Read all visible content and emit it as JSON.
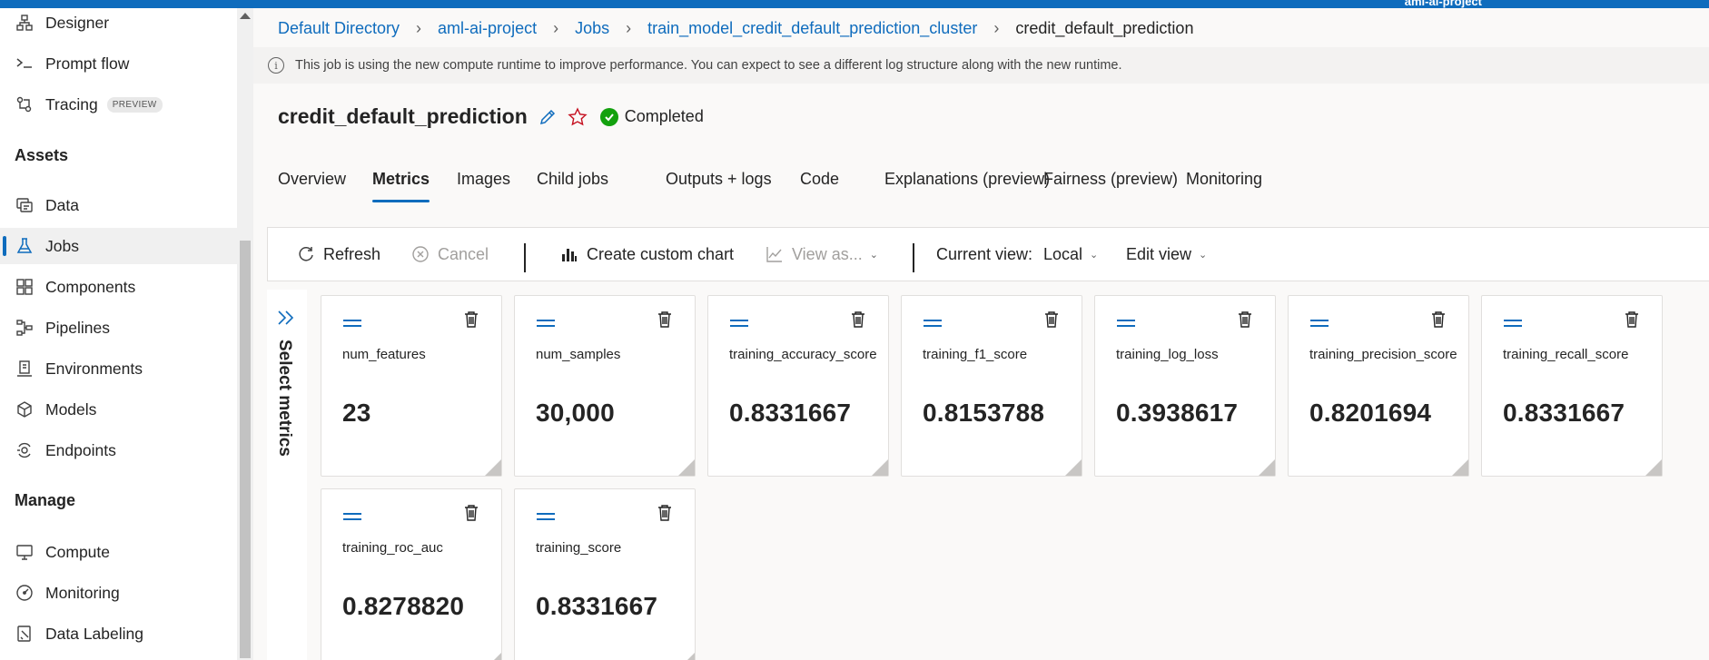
{
  "topbar": {
    "project_name": "aml-ai-project"
  },
  "sidebar": {
    "items": [
      {
        "label": "Designer",
        "icon": "designer-icon"
      },
      {
        "label": "Prompt flow",
        "icon": "prompt-flow-icon"
      },
      {
        "label": "Tracing",
        "icon": "tracing-icon",
        "badge": "PREVIEW"
      }
    ],
    "assets_heading": "Assets",
    "assets": [
      {
        "label": "Data",
        "icon": "data-icon"
      },
      {
        "label": "Jobs",
        "icon": "jobs-icon",
        "active": true
      },
      {
        "label": "Components",
        "icon": "components-icon"
      },
      {
        "label": "Pipelines",
        "icon": "pipelines-icon"
      },
      {
        "label": "Environments",
        "icon": "environments-icon"
      },
      {
        "label": "Models",
        "icon": "models-icon"
      },
      {
        "label": "Endpoints",
        "icon": "endpoints-icon"
      }
    ],
    "manage_heading": "Manage",
    "manage": [
      {
        "label": "Compute",
        "icon": "compute-icon"
      },
      {
        "label": "Monitoring",
        "icon": "monitoring-icon"
      },
      {
        "label": "Data Labeling",
        "icon": "data-labeling-icon"
      }
    ]
  },
  "breadcrumb": {
    "items": [
      "Default Directory",
      "aml-ai-project",
      "Jobs",
      "train_model_credit_default_prediction_cluster"
    ],
    "current": "credit_default_prediction"
  },
  "info_bar": {
    "message": "This job is using the new compute runtime to improve performance. You can expect to see a different log structure along with the new runtime."
  },
  "job": {
    "title": "credit_default_prediction",
    "status": "Completed",
    "status_color": "#13a10e"
  },
  "tabs": [
    {
      "label": "Overview"
    },
    {
      "label": "Metrics",
      "active": true
    },
    {
      "label": "Images"
    },
    {
      "label": "Child jobs"
    },
    {
      "label": "Outputs + logs"
    },
    {
      "label": "Code"
    },
    {
      "label": "Explanations (preview)"
    },
    {
      "label": "Fairness (preview)"
    },
    {
      "label": "Monitoring"
    }
  ],
  "toolbar": {
    "refresh": "Refresh",
    "cancel": "Cancel",
    "create_chart": "Create custom chart",
    "view_as": "View as...",
    "current_view_label": "Current view:",
    "current_view_value": "Local",
    "edit_view": "Edit view"
  },
  "select_metrics_label": "Select metrics",
  "metrics": [
    {
      "name": "num_features",
      "value": "23"
    },
    {
      "name": "num_samples",
      "value": "30,000"
    },
    {
      "name": "training_accuracy_score",
      "value": "0.8331667"
    },
    {
      "name": "training_f1_score",
      "value": "0.8153788"
    },
    {
      "name": "training_log_loss",
      "value": "0.3938617"
    },
    {
      "name": "training_precision_score",
      "value": "0.8201694"
    },
    {
      "name": "training_recall_score",
      "value": "0.8331667"
    },
    {
      "name": "training_roc_auc",
      "value": "0.8278820"
    },
    {
      "name": "training_score",
      "value": "0.8331667"
    }
  ],
  "colors": {
    "accent": "#0f6cbd",
    "success": "#13a10e"
  }
}
